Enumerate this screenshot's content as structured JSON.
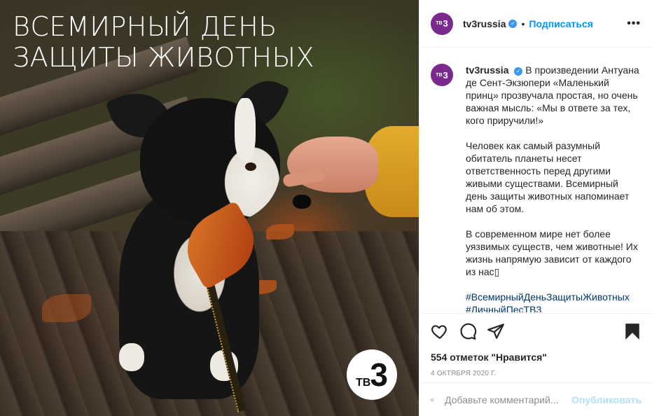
{
  "media": {
    "overlay_title_line1": "Всемирный день",
    "overlay_title_line2": "защиты животных",
    "logo_tv": "ТВ",
    "logo_num": "3"
  },
  "header": {
    "avatar_tv": "ТВ",
    "avatar_num": "3",
    "username": "tv3russia",
    "verified_icon": "verified-check-icon",
    "separator": "•",
    "follow_label": "Подписаться",
    "more_icon": "more-options-icon",
    "more_label": "•••"
  },
  "caption": {
    "username": "tv3russia",
    "paragraphs": [
      "В произведении Антуана де Сент-Экзюпери «Маленький принц» прозвучала простая, но очень важная мысль: «Мы в ответе за тех, кого приручили!»",
      "Человек как самый разумный обитатель планеты несет ответственность перед другими живыми существами. Всемирный день защиты животных напоминает нам об этом.",
      "В современном мире нет более уязвимых существ, чем животные! Их жизнь напрямую зависит от каждого из нас"
    ],
    "hashtags": [
      "#ВсемирныйДеньЗащитыЖивотных",
      "#ЛичныйПесТВ3"
    ]
  },
  "actions": {
    "like_icon": "heart-icon",
    "comment_icon": "comment-bubble-icon",
    "share_icon": "share-paper-plane-icon",
    "save_icon": "bookmark-icon",
    "likes_text": "554 отметок \"Нравится\"",
    "date_text": "4 октября 2020 г."
  },
  "comment_bar": {
    "emoji_icon": "smiley-icon",
    "placeholder": "Добавьте комментарий...",
    "post_label": "Опубликовать"
  },
  "colors": {
    "link_blue": "#0095f6",
    "hashtag_blue": "#00376b",
    "brand_purple": "#7a2a8c",
    "muted_gray": "#8e8e8e"
  }
}
